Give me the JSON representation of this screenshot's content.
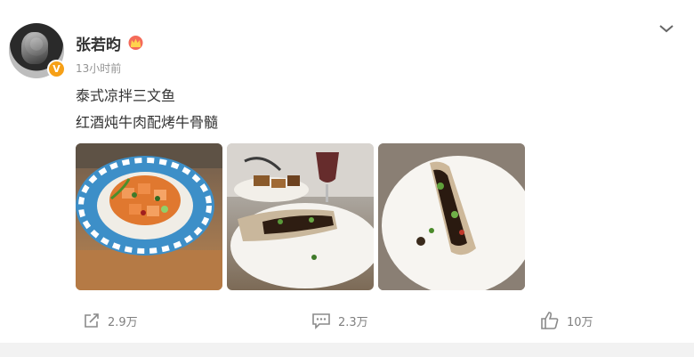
{
  "post": {
    "author": "张若昀",
    "time": "13小时前",
    "lines": [
      "泰式凉拌三文鱼",
      "红酒炖牛肉配烤牛骨髓"
    ],
    "images": [
      {
        "icon": "photo-salmon-salad"
      },
      {
        "icon": "photo-beef-bone-marrow-wine"
      },
      {
        "icon": "photo-beef-bone-marrow-plate"
      }
    ]
  },
  "actions": {
    "share_count": "2.9万",
    "comment_count": "2.3万",
    "like_count": "10万"
  },
  "colors": {
    "accent": "#f6a017",
    "muted": "#939393"
  }
}
